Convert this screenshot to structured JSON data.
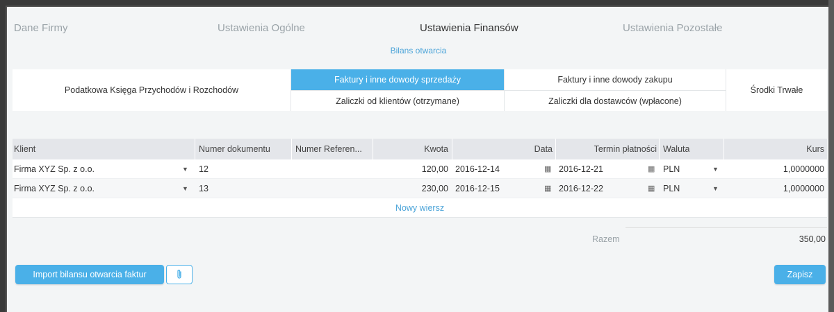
{
  "main_tabs": [
    {
      "label": "Dane Firmy",
      "active": false
    },
    {
      "label": "Ustawienia Ogólne",
      "active": false
    },
    {
      "label": "Ustawienia Finansów",
      "active": true
    },
    {
      "label": "Ustawienia Pozostałe",
      "active": false
    }
  ],
  "subheading": "Bilans otwarcia",
  "doc_tabs": {
    "pkpir": "Podatkowa Księga Przychodów i Rozchodów",
    "sales_invoices": "Faktury i inne dowody sprzedaży",
    "purchase_invoices": "Faktury i inne dowody zakupu",
    "fixed_assets": "Środki Trwałe",
    "client_advances": "Zaliczki od klientów (otrzymane)",
    "supplier_advances": "Zaliczki dla dostawców (wpłacone)",
    "active": "sales_invoices"
  },
  "table": {
    "columns": {
      "client": "Klient",
      "doc_number": "Numer dokumentu",
      "ref_number": "Numer Referen...",
      "amount": "Kwota",
      "date": "Data",
      "due_date": "Termin płatności",
      "currency": "Waluta",
      "rate": "Kurs"
    },
    "rows": [
      {
        "client": "Firma XYZ Sp. z o.o.",
        "doc_number": "12",
        "ref_number": "",
        "amount": "120,00",
        "date": "2016-12-14",
        "due_date": "2016-12-21",
        "currency": "PLN",
        "rate": "1,0000000"
      },
      {
        "client": "Firma XYZ Sp. z o.o.",
        "doc_number": "13",
        "ref_number": "",
        "amount": "230,00",
        "date": "2016-12-15",
        "due_date": "2016-12-22",
        "currency": "PLN",
        "rate": "1,0000000"
      }
    ],
    "new_row_label": "Nowy wiersz"
  },
  "summary": {
    "label": "Razem",
    "value": "350,00"
  },
  "buttons": {
    "import_label": "Import bilansu otwarcia faktur",
    "save_label": "Zapisz"
  },
  "icons": {
    "dropdown": "chevron-down-icon",
    "calendar": "calendar-icon",
    "attach": "paperclip-icon"
  },
  "colors": {
    "accent": "#4ab0e8",
    "link": "#4aa3d8"
  }
}
